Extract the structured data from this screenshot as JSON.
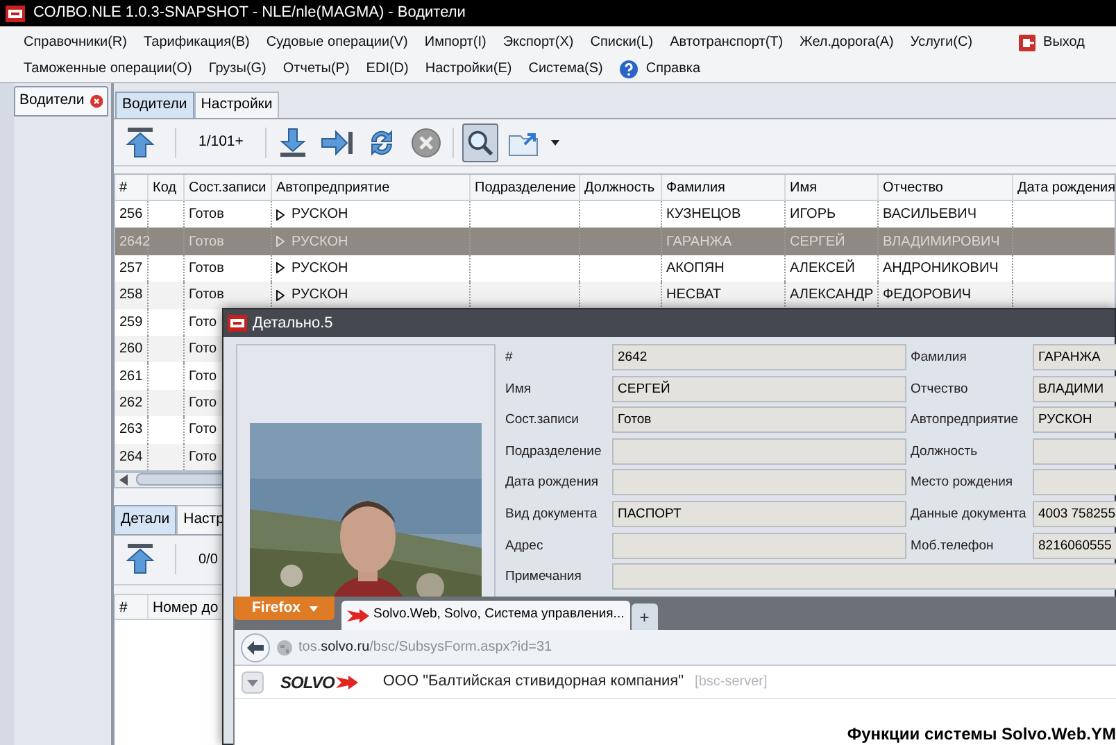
{
  "window": {
    "title": "СОЛВО.NLE 1.0.3-SNAPSHOT - NLE/nle(MAGMA) - Водители"
  },
  "menu_rows": [
    [
      {
        "label": "Справочники(R)",
        "kind": "menu"
      },
      {
        "label": "Тарификация(B)",
        "kind": "menu"
      },
      {
        "label": "Судовые операции(V)",
        "kind": "menu"
      },
      {
        "label": "Импорт(I)",
        "kind": "menu"
      },
      {
        "label": "Экспорт(X)",
        "kind": "menu"
      },
      {
        "label": "Списки(L)",
        "kind": "menu"
      },
      {
        "label": "Автотранспорт(T)",
        "kind": "menu"
      },
      {
        "label": "Жел.дорога(A)",
        "kind": "menu"
      },
      {
        "label": "Услуги(C)",
        "kind": "menu"
      },
      {
        "label": "Выход",
        "kind": "exit"
      }
    ],
    [
      {
        "label": "Таможенные операции(O)",
        "kind": "menu"
      },
      {
        "label": "Грузы(G)",
        "kind": "menu"
      },
      {
        "label": "Отчеты(P)",
        "kind": "menu"
      },
      {
        "label": "EDI(D)",
        "kind": "menu"
      },
      {
        "label": "Настройки(E)",
        "kind": "menu"
      },
      {
        "label": "Система(S)",
        "kind": "menu"
      },
      {
        "label": "Справка",
        "kind": "help"
      }
    ]
  ],
  "doc_tabs": [
    {
      "label": "Водители",
      "selected": true
    }
  ],
  "tabs": [
    {
      "label": "Водители",
      "selected": true
    },
    {
      "label": "Настройки",
      "selected": false
    }
  ],
  "toolbar": {
    "counter": "1/101+",
    "search_active": true
  },
  "table": {
    "columns": [
      "#",
      "Код",
      "Сост.записи",
      "Автопредприятие",
      "Подразделение",
      "Должность",
      "Фамилия",
      "Имя",
      "Отчество",
      "Дата рождения"
    ],
    "rows": [
      {
        "cells": [
          "256",
          "",
          "Готов",
          "РУСКОН",
          "",
          "",
          "КУЗНЕЦОВ",
          "ИГОРЬ",
          "ВАСИЛЬЕВИЧ",
          ""
        ],
        "selected": false
      },
      {
        "cells": [
          "2642",
          "",
          "Готов",
          "РУСКОН",
          "",
          "",
          "ГАРАНЖА",
          "СЕРГЕЙ",
          "ВЛАДИМИРОВИЧ",
          ""
        ],
        "selected": true
      },
      {
        "cells": [
          "257",
          "",
          "Готов",
          "РУСКОН",
          "",
          "",
          "АКОПЯН",
          "АЛЕКСЕЙ",
          "АНДРОНИКОВИЧ",
          ""
        ],
        "selected": false
      },
      {
        "cells": [
          "258",
          "",
          "Готов",
          "РУСКОН",
          "",
          "",
          "НЕСВАТ",
          "АЛЕКСАНДР",
          "ФЕДОРОВИЧ",
          ""
        ],
        "selected": false
      },
      {
        "cells": [
          "259",
          "",
          "Гото"
        ],
        "selected": false
      },
      {
        "cells": [
          "260",
          "",
          "Гото"
        ],
        "selected": false
      },
      {
        "cells": [
          "261",
          "",
          "Гото"
        ],
        "selected": false
      },
      {
        "cells": [
          "262",
          "",
          "Гото"
        ],
        "selected": false
      },
      {
        "cells": [
          "263",
          "",
          "Гото"
        ],
        "selected": false
      },
      {
        "cells": [
          "264",
          "",
          "Гото"
        ],
        "selected": false
      }
    ]
  },
  "bottom_panel": {
    "tabs": [
      {
        "label": "Детали",
        "selected": true
      },
      {
        "label": "Настр",
        "selected": false
      }
    ],
    "counter": "0/0",
    "columns": [
      "#",
      "Номер до"
    ]
  },
  "detail_window": {
    "title": "Детально.5",
    "rows": [
      {
        "left": {
          "label": "#",
          "value": "2642"
        },
        "right": {
          "label": "Фамилия",
          "value": "ГАРАНЖА"
        }
      },
      {
        "left": {
          "label": "Имя",
          "value": "СЕРГЕЙ"
        },
        "right": {
          "label": "Отчество",
          "value": "ВЛАДИМИ"
        }
      },
      {
        "left": {
          "label": "Сост.записи",
          "value": "Готов"
        },
        "right": {
          "label": "Автопредприятие",
          "value": "РУСКОН"
        }
      },
      {
        "left": {
          "label": "Подразделение"
        },
        "right": {
          "label": "Должность"
        }
      },
      {
        "left": {
          "label": "Дата рождения"
        },
        "right": {
          "label": "Место рождения"
        }
      },
      {
        "left": {
          "label": "Вид документа",
          "value": "ПАСПОРТ"
        },
        "right": {
          "label": "Данные документа",
          "value": "4003 758255"
        }
      },
      {
        "left": {
          "label": "Адрес"
        },
        "right": {
          "label": "Моб.телефон",
          "value": "8216060555"
        }
      },
      {
        "left": {
          "label": "Примечания"
        }
      }
    ]
  },
  "browser": {
    "menu_button": "Firefox",
    "tabs": [
      {
        "label": "Solvo.Web, Solvo, Система управления...",
        "selected": true
      }
    ],
    "new_tab": "+",
    "url": "tos.**solvo.ru**/bsc/SubsysForm.aspx?id=31",
    "logo_text": "SOLVO",
    "org": "ООО \"Балтийская стивидорная компания\"",
    "server": "[bsc-server]",
    "heading": "Функции системы Solvo.Web.YM"
  }
}
